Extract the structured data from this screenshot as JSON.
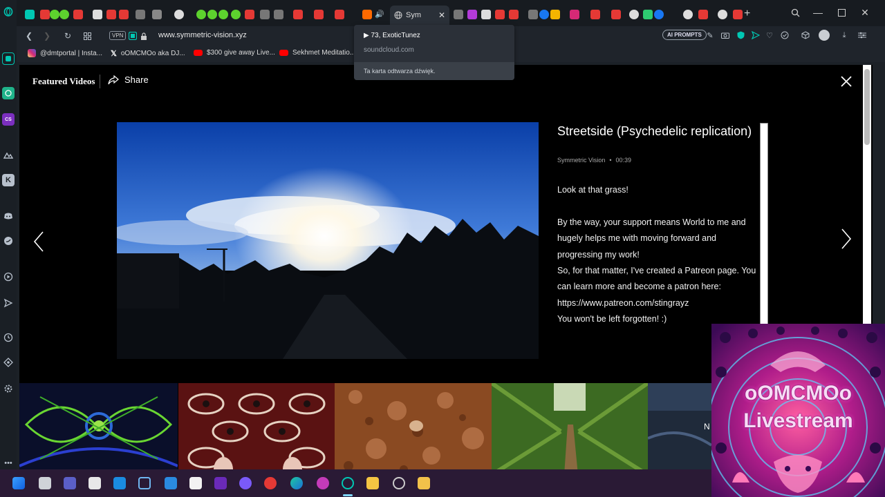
{
  "browser": {
    "active_tab_title": "Sym",
    "url": "www.symmetric-vision.xyz",
    "vpn_label": "VPN",
    "ai_prompts_label": "AI PROMPTS"
  },
  "bookmarks": [
    {
      "label": "@dmtportal | Insta...",
      "icon": "instagram-icon",
      "color": "#d62976"
    },
    {
      "label": "oOMCMOo aka DJ...",
      "icon": "x-icon",
      "color": "#ffffff"
    },
    {
      "label": "$300 give away Live...",
      "icon": "youtube-icon",
      "color": "#ff0000"
    },
    {
      "label": "Sekhmet Meditatio...",
      "icon": "youtube-icon",
      "color": "#ff0000"
    }
  ],
  "tooltip": {
    "title": "▶ 73, ExoticTunez",
    "domain": "soundcloud.com",
    "note": "Ta karta odtwarza dźwięk."
  },
  "gallery": {
    "header": "Featured Videos",
    "share_label": "Share",
    "video": {
      "title": "Streetside (Psychedelic replication)",
      "channel": "Symmetric Vision",
      "separator": "•",
      "duration": "00:39",
      "description": [
        "Look at that grass!",
        "",
        "By the way, your support means World to me and hugely helps me with moving forward and progressing my work!",
        "So, for that matter, I've created a Patreon page. You can learn more and become a patron here:",
        "https://www.patreon.com/stingrayz",
        "You won't be left forgotten! :)"
      ]
    },
    "thumbnail_overlay_letter": "N"
  },
  "livestream": {
    "line1": "oOMCMOo",
    "line2": "Livestream"
  },
  "colors": {
    "accent": "#00c8b4",
    "browser_bg": "#1c2127",
    "page_bg": "#000000",
    "taskbar_bg": "#2a1a35"
  }
}
